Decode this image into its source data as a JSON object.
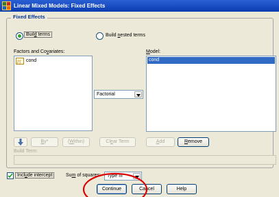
{
  "window": {
    "title": "Linear Mixed Models: Fixed Effects"
  },
  "fixed_effects": {
    "legend": "Fixed Effects",
    "build_terms": {
      "pre": "Buil",
      "u": "d",
      "post": " terms"
    },
    "build_nested": {
      "pre": "Build ",
      "u": "n",
      "post": "ested terms"
    },
    "factors_label": {
      "pre": "Factors and Co",
      "u": "v",
      "post": "ariates:"
    },
    "factors_items": [
      {
        "label": "cond",
        "icon": "scale-variable-icon"
      }
    ],
    "model_label": {
      "pre": "",
      "u": "M",
      "post": "odel:"
    },
    "model_items": [
      {
        "label": "cond",
        "selected": true
      }
    ],
    "factorial_value": "Factorial",
    "toolbar": {
      "by_label": {
        "pre": "",
        "u": "B",
        "post": "y*"
      },
      "within_label": {
        "pre": "(",
        "u": "W",
        "post": "ithin)"
      },
      "clear_label": {
        "pre": "Cl",
        "u": "e",
        "post": "ar Term"
      },
      "add_label": {
        "pre": "",
        "u": "A",
        "post": "dd"
      },
      "remove_label": {
        "pre": "",
        "u": "R",
        "post": "emove"
      }
    },
    "build_term_label": "Build Term:",
    "build_term_value": ""
  },
  "footer": {
    "include_intercept": {
      "pre": "Incl",
      "u": "u",
      "post": "de intercept",
      "checked": true
    },
    "sum_squares": {
      "pre": "Su",
      "u": "m",
      "post": " of squares:"
    },
    "sum_squares_value": "Type III",
    "continue_label": "Continue",
    "cancel_label": "Cancel",
    "help_label": "Help"
  },
  "colors": {
    "title_bar": "#0a3cb0",
    "selection": "#316ac5",
    "annotation_circle": "#dd0000",
    "dialog_bg": "#ece9d8"
  }
}
